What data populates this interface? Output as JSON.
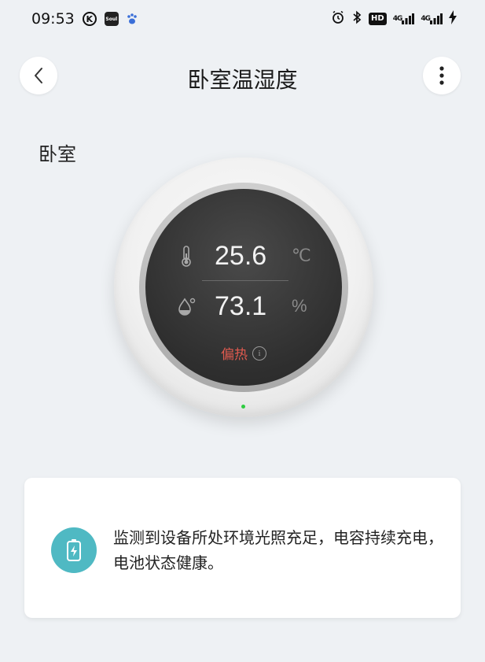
{
  "status_bar": {
    "time": "09:53",
    "app_icons": [
      "k-icon",
      "soul-icon",
      "paw-icon"
    ],
    "right_icons": [
      "alarm-icon",
      "bluetooth-icon",
      "hd-icon",
      "signal-4g-icon",
      "signal-4g-icon",
      "charging-icon"
    ],
    "hd_label": "HD",
    "network_label_1": "4G",
    "network_label_2": "4G"
  },
  "header": {
    "title": "卧室温湿度",
    "back_icon": "chevron-left-icon",
    "more_icon": "more-vertical-icon"
  },
  "room": {
    "name": "卧室"
  },
  "device": {
    "temperature": "25.6",
    "temperature_unit": "℃",
    "humidity": "73.1",
    "humidity_unit": "%",
    "status": "偏热",
    "status_color": "#e05a4f",
    "led_color": "#2ecc40"
  },
  "notice": {
    "icon": "battery-charging-icon",
    "icon_bg": "#4fb9c3",
    "text": "监测到设备所处环境光照充足，电容持续充电，电池状态健康。"
  }
}
